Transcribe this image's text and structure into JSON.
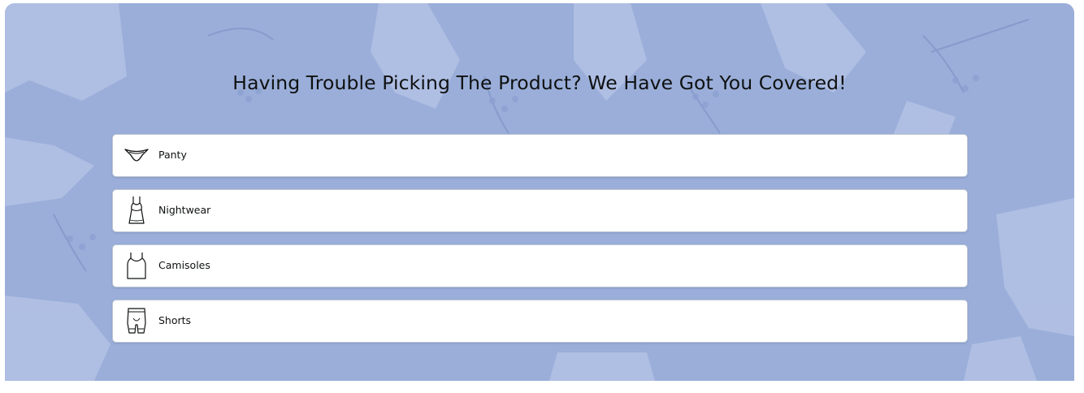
{
  "section": {
    "title": "Having Trouble Picking The Product? We Have Got You Covered!",
    "background_color": "#9aaed9"
  },
  "products": [
    {
      "label": "Panty",
      "icon": "panty-icon"
    },
    {
      "label": "Nightwear",
      "icon": "nightwear-icon"
    },
    {
      "label": "Camisoles",
      "icon": "camisole-icon"
    },
    {
      "label": "Shorts",
      "icon": "shorts-icon"
    }
  ]
}
